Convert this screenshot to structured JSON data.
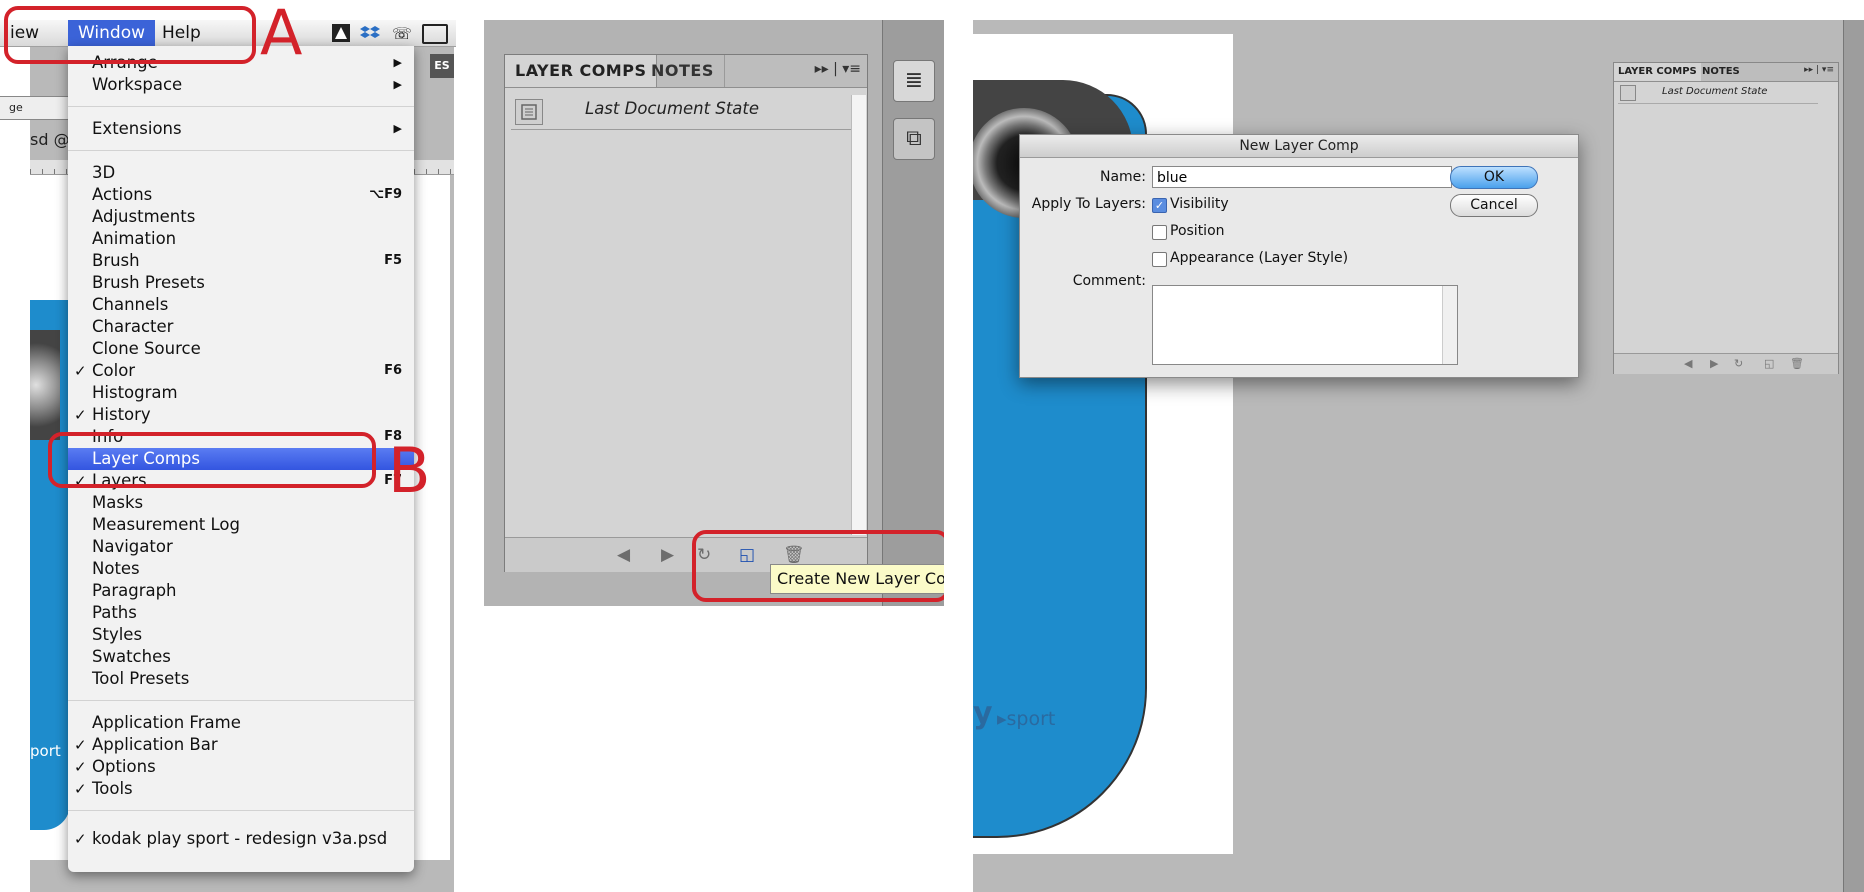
{
  "menubar": {
    "items": [
      "iew",
      "Window",
      "Help"
    ],
    "active": "Window",
    "es_badge": "ES",
    "extra_icons": [
      "adobe-icon",
      "dropbox-icon",
      "phone-icon",
      "display-icon"
    ]
  },
  "background_fragments": {
    "ge_label": "ge",
    "sd_label": "sd @",
    "sport_label": "port"
  },
  "window_menu": {
    "items": [
      {
        "label": "Arrange",
        "submenu": true
      },
      {
        "label": "Workspace",
        "submenu": true
      },
      {
        "label": "Extensions",
        "submenu": true
      },
      {
        "label": "3D"
      },
      {
        "label": "Actions",
        "shortcut": "⌥F9"
      },
      {
        "label": "Adjustments"
      },
      {
        "label": "Animation"
      },
      {
        "label": "Brush",
        "shortcut": "F5"
      },
      {
        "label": "Brush Presets"
      },
      {
        "label": "Channels"
      },
      {
        "label": "Character"
      },
      {
        "label": "Clone Source"
      },
      {
        "label": "Color",
        "shortcut": "F6",
        "checked": true
      },
      {
        "label": "Histogram"
      },
      {
        "label": "History",
        "checked": true
      },
      {
        "label": "Info",
        "shortcut": "F8"
      },
      {
        "label": "Layer Comps",
        "highlighted": true
      },
      {
        "label": "Layers",
        "shortcut": "F7",
        "checked": true
      },
      {
        "label": "Masks"
      },
      {
        "label": "Measurement Log"
      },
      {
        "label": "Navigator"
      },
      {
        "label": "Notes"
      },
      {
        "label": "Paragraph"
      },
      {
        "label": "Paths"
      },
      {
        "label": "Styles"
      },
      {
        "label": "Swatches"
      },
      {
        "label": "Tool Presets"
      },
      {
        "label": "Application Frame"
      },
      {
        "label": "Application Bar",
        "checked": true
      },
      {
        "label": "Options",
        "checked": true
      },
      {
        "label": "Tools",
        "checked": true
      },
      {
        "label": "kodak play sport - redesign v3a.psd",
        "checked": true
      }
    ],
    "check_glyph": "✓",
    "submenu_glyph": "▶"
  },
  "annotations": {
    "a": "A",
    "b": "B"
  },
  "layer_comps_panel": {
    "tabs": [
      "LAYER COMPS",
      "NOTES"
    ],
    "menu_glyph": "▸▸ | ▾≡",
    "rows": [
      {
        "label": "Last Document State"
      }
    ],
    "bottom_icons": [
      "◀",
      "▶",
      "↻",
      "◱",
      "🗑"
    ],
    "tooltip": "Create New Layer Cor",
    "dock_icons": [
      "≣",
      "⧉"
    ]
  },
  "new_layer_comp_dialog": {
    "title": "New Layer Comp",
    "name_label": "Name:",
    "name_value": "blue",
    "apply_label": "Apply To Layers:",
    "options": [
      {
        "label": "Visibility",
        "checked": true
      },
      {
        "label": "Position",
        "checked": false
      },
      {
        "label": "Appearance (Layer Style)",
        "checked": false
      }
    ],
    "comment_label": "Comment:",
    "ok_label": "OK",
    "cancel_label": "Cancel",
    "checkbox_glyph": "✓"
  },
  "mini_panel": {
    "tabs": [
      "LAYER COMPS",
      "NOTES"
    ],
    "rows": [
      {
        "label": "Last Document State"
      }
    ],
    "menu_glyph": "▸▸ | ▾≡",
    "bottom_icons": [
      "◀",
      "▶",
      "↻",
      "◱",
      "🗑"
    ]
  },
  "camera_art": {
    "logo_letter": "y",
    "logo_word": "▸sport"
  },
  "colors": {
    "annotation_red": "#d3222a",
    "menu_highlight": "#3b63d8",
    "camera_blue": "#1e8ccc",
    "tooltip_bg": "#fbfbc8"
  }
}
